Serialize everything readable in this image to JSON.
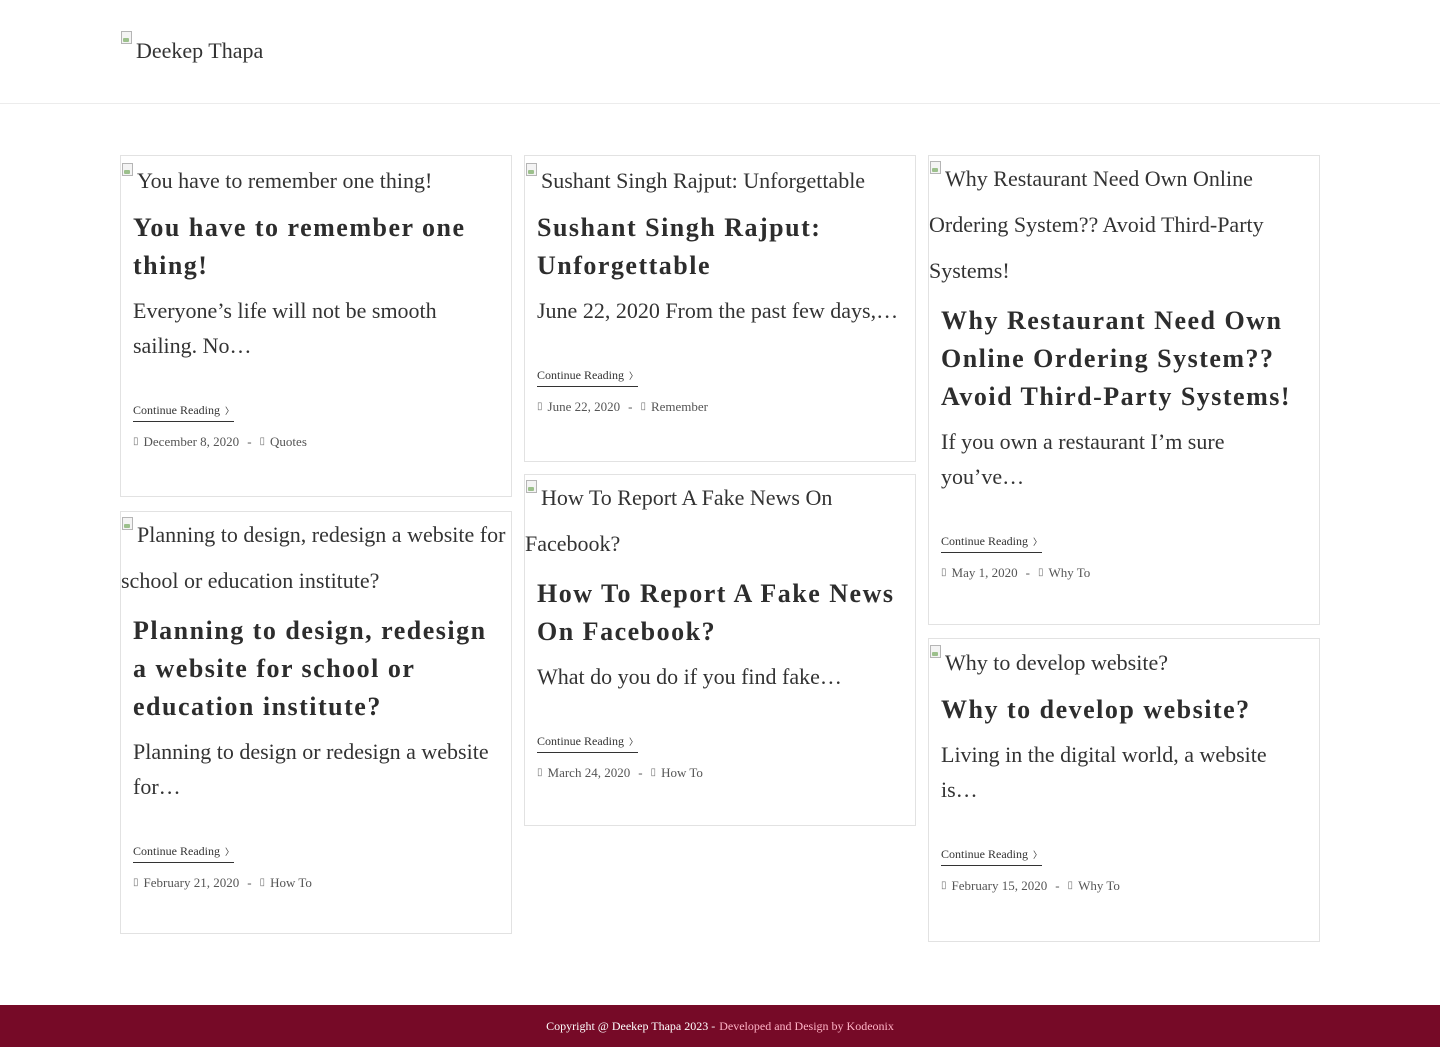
{
  "site": {
    "logo_alt": "Deekep Thapa"
  },
  "posts": [
    {
      "image_alt": "You have to remember one thing!",
      "title": "You have to remember one thing!",
      "excerpt": "Everyone’s life will not be smooth sailing. No…",
      "more_label": "Continue Reading",
      "date": "December 8, 2020",
      "category": "Quotes"
    },
    {
      "image_alt": "Planning to design, redesign a website for school or education institute?",
      "title": "Planning to design, redesign a website for school or education institute?",
      "excerpt": "Planning to design or redesign a website for…",
      "more_label": "Continue Reading",
      "date": "February 21, 2020",
      "category": "How To"
    },
    {
      "image_alt": "Sushant Singh Rajput: Unforgettable",
      "title": "Sushant Singh Rajput: Unforgettable",
      "excerpt": "June 22, 2020 From the past few days,…",
      "more_label": "Continue Reading",
      "date": "June 22, 2020",
      "category": "Remember"
    },
    {
      "image_alt": "How To Report A Fake News On Facebook?",
      "title": "How To Report A Fake News On Facebook?",
      "excerpt": "What do you do if you find fake…",
      "more_label": "Continue Reading",
      "date": "March 24, 2020",
      "category": "How To"
    },
    {
      "image_alt": "Why Restaurant Need Own Online Ordering System?? Avoid Third-Party Systems!",
      "title": "Why Restaurant Need Own Online Ordering System?? Avoid Third-Party Systems!",
      "excerpt": "If you own a restaurant I’m sure you’ve…",
      "more_label": "Continue Reading",
      "date": "May 1, 2020",
      "category": "Why To"
    },
    {
      "image_alt": "Why to develop website?",
      "title": "Why to develop website?",
      "excerpt": "Living in the digital world, a website is…",
      "more_label": "Continue Reading",
      "date": "February 15, 2020",
      "category": "Why To"
    }
  ],
  "icons": {
    "calendar": "calendar-icon",
    "folder": "folder-icon",
    "chevron": "chevron-right-icon"
  },
  "footer": {
    "copyright": "Copyright @ Deekep Thapa 2023 -",
    "credit": "Developed and Design by Kodeonix"
  },
  "colors": {
    "footer_bg": "#760a27",
    "footer_credit": "#ffb3c6"
  }
}
